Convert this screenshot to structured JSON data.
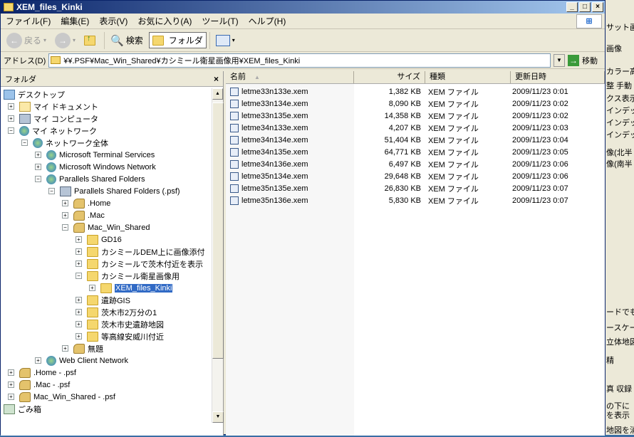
{
  "window": {
    "title": "XEM_files_Kinki"
  },
  "title_buttons": [
    "_",
    "□",
    "×"
  ],
  "menu": [
    "ファイル(F)",
    "編集(E)",
    "表示(V)",
    "お気に入り(A)",
    "ツール(T)",
    "ヘルプ(H)"
  ],
  "toolbar": {
    "back": "戻る",
    "search": "検索",
    "folders": "フォルダ"
  },
  "address": {
    "label": "アドレス(D)",
    "path": "¥¥.PSF¥Mac_Win_Shared¥カシミール衛星画像用¥XEM_files_Kinki",
    "go": "移動"
  },
  "folder_pane": {
    "title": "フォルダ",
    "close": "×",
    "tree": [
      {
        "label": "デスクトップ",
        "icon": "desktop-icon",
        "level": 0,
        "expander": ""
      },
      {
        "label": "マイ ドキュメント",
        "icon": "documents-icon",
        "level": 1,
        "expander": "+"
      },
      {
        "label": "マイ コンピュータ",
        "icon": "computer-icon",
        "level": 1,
        "expander": "+"
      },
      {
        "label": "マイ ネットワーク",
        "icon": "network-icon",
        "level": 1,
        "expander": "−"
      },
      {
        "label": "ネットワーク全体",
        "icon": "globe-icon",
        "level": 2,
        "expander": "−"
      },
      {
        "label": "Microsoft Terminal Services",
        "icon": "globe-icon",
        "level": 3,
        "expander": "+"
      },
      {
        "label": "Microsoft Windows Network",
        "icon": "globe-icon",
        "level": 3,
        "expander": "+"
      },
      {
        "label": "Parallels Shared Folders",
        "icon": "globe-icon",
        "level": 3,
        "expander": "−"
      },
      {
        "label": "Parallels Shared Folders (.psf)",
        "icon": "computer-icon",
        "level": 4,
        "expander": "−"
      },
      {
        "label": ".Home",
        "icon": "share-icon",
        "level": 5,
        "expander": "+"
      },
      {
        "label": ".Mac",
        "icon": "share-icon",
        "level": 5,
        "expander": "+"
      },
      {
        "label": "Mac_Win_Shared",
        "icon": "share-icon",
        "level": 5,
        "expander": "−"
      },
      {
        "label": "GD16",
        "icon": "folder-icon",
        "level": 6,
        "expander": "+"
      },
      {
        "label": "カシミールDEM上に画像添付",
        "icon": "folder-icon",
        "level": 6,
        "expander": "+"
      },
      {
        "label": "カシミールで茨木付近を表示",
        "icon": "folder-icon",
        "level": 6,
        "expander": "+"
      },
      {
        "label": "カシミール衛星画像用",
        "icon": "folder-icon",
        "level": 6,
        "expander": "−"
      },
      {
        "label": "XEM_files_Kinki",
        "icon": "folder-icon",
        "level": 7,
        "expander": "+",
        "selected": true
      },
      {
        "label": "遺跡GIS",
        "icon": "folder-icon",
        "level": 6,
        "expander": "+"
      },
      {
        "label": "茨木市2万分の1",
        "icon": "folder-icon",
        "level": 6,
        "expander": "+"
      },
      {
        "label": "茨木市史遺跡地図",
        "icon": "folder-icon",
        "level": 6,
        "expander": "+"
      },
      {
        "label": "等高線安威川付近",
        "icon": "folder-icon",
        "level": 6,
        "expander": "+"
      },
      {
        "label": "無題",
        "icon": "share-icon",
        "level": 5,
        "expander": "+"
      },
      {
        "label": "Web Client Network",
        "icon": "globe-icon",
        "level": 3,
        "expander": "+"
      },
      {
        "label": ".Home - .psf",
        "icon": "share-icon",
        "level": 1,
        "expander": "+"
      },
      {
        "label": ".Mac - .psf",
        "icon": "share-icon",
        "level": 1,
        "expander": "+"
      },
      {
        "label": "Mac_Win_Shared - .psf",
        "icon": "share-icon",
        "level": 1,
        "expander": "+"
      },
      {
        "label": "ごみ箱",
        "icon": "trash-icon",
        "level": 0,
        "expander": ""
      }
    ]
  },
  "file_list": {
    "columns": [
      "名前",
      "サイズ",
      "種類",
      "更新日時"
    ],
    "sort_arrow": "▲",
    "rows": [
      {
        "name": "letme33n133e.xem",
        "size": "1,382 KB",
        "type": "XEM ファイル",
        "date": "2009/11/23 0:01"
      },
      {
        "name": "letme33n134e.xem",
        "size": "8,090 KB",
        "type": "XEM ファイル",
        "date": "2009/11/23 0:02"
      },
      {
        "name": "letme33n135e.xem",
        "size": "14,358 KB",
        "type": "XEM ファイル",
        "date": "2009/11/23 0:02"
      },
      {
        "name": "letme34n133e.xem",
        "size": "4,207 KB",
        "type": "XEM ファイル",
        "date": "2009/11/23 0:03"
      },
      {
        "name": "letme34n134e.xem",
        "size": "51,404 KB",
        "type": "XEM ファイル",
        "date": "2009/11/23 0:04"
      },
      {
        "name": "letme34n135e.xem",
        "size": "64,771 KB",
        "type": "XEM ファイル",
        "date": "2009/11/23 0:05"
      },
      {
        "name": "letme34n136e.xem",
        "size": "6,497 KB",
        "type": "XEM ファイル",
        "date": "2009/11/23 0:06"
      },
      {
        "name": "letme35n134e.xem",
        "size": "29,648 KB",
        "type": "XEM ファイル",
        "date": "2009/11/23 0:06"
      },
      {
        "name": "letme35n135e.xem",
        "size": "26,830 KB",
        "type": "XEM ファイル",
        "date": "2009/11/23 0:07"
      },
      {
        "name": "letme35n136e.xem",
        "size": "5,830 KB",
        "type": "XEM ファイル",
        "date": "2009/11/23 0:07"
      }
    ]
  },
  "background_window": {
    "snippets": [
      "サット画",
      "画像",
      "カラー高",
      "整 手動",
      "クス表示",
      "インデッ",
      "インデッ",
      "インデッ",
      "像(北半",
      "像(南半",
      "ードでも",
      "ースケー",
      "立体地図",
      "精",
      "真 収録",
      "の下に",
      "を表示",
      "地図を消す"
    ]
  },
  "colors": {
    "selection": "#316ac5",
    "titlebar": "#0a246a",
    "desktop": "#3a6ea5"
  }
}
